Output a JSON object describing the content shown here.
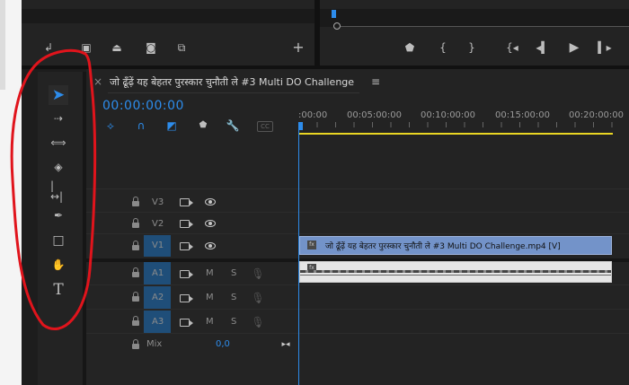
{
  "sequence": {
    "title": "जो ढूँढ़ें यह बेहतर पुरस्कार चुनौती ले #3 Multi DO Challenge",
    "timecode": "00:00:00:00"
  },
  "ruler": {
    "ticks": [
      ":00:00",
      "00:05:00:00",
      "00:10:00:00",
      "00:15:00:00",
      "00:20:00:00"
    ]
  },
  "tracks": {
    "video": [
      {
        "name": "V3"
      },
      {
        "name": "V2"
      },
      {
        "name": "V1",
        "targeted": true
      }
    ],
    "audio": [
      {
        "name": "A1",
        "m": "M",
        "s": "S"
      },
      {
        "name": "A2",
        "m": "M",
        "s": "S"
      },
      {
        "name": "A3",
        "m": "M",
        "s": "S"
      }
    ],
    "mix": {
      "label": "Mix",
      "value": "0,0"
    }
  },
  "clips": {
    "video_label": "जो ढूँढ़ें यह बेहतर पुरस्कार चुनौती ले #3 Multi DO Challenge.mp4 [V]",
    "fx": "fx"
  },
  "tools": [
    "selection-tool",
    "track-select-tool",
    "ripple-edit-tool",
    "razor-tool",
    "slip-tool",
    "pen-tool",
    "rectangle-tool",
    "hand-tool",
    "type-tool"
  ],
  "tool_type_glyph": "T",
  "colors": {
    "accent": "#2d8ceb",
    "annotation": "#e0141c",
    "clip_video": "#7393c9",
    "track_target": "#1f4e79",
    "work_area": "#e9d523"
  }
}
